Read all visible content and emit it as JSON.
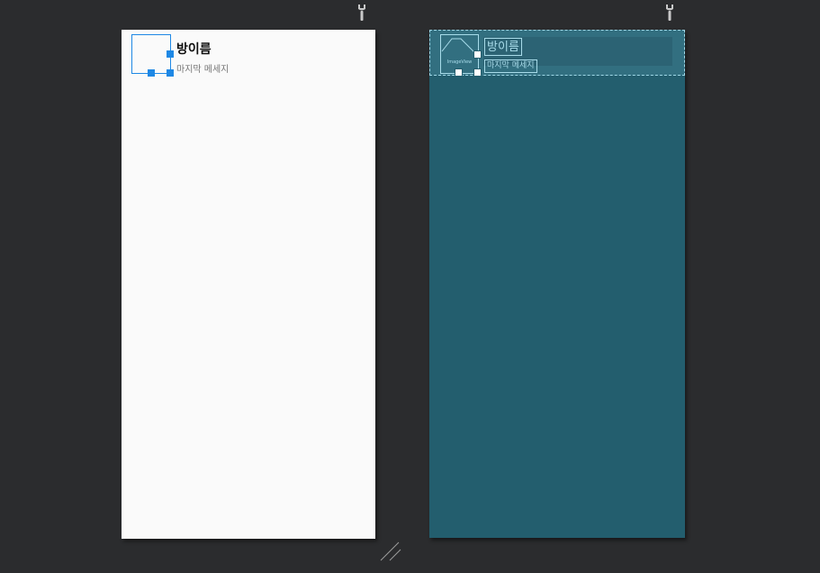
{
  "design": {
    "room_name": "방이름",
    "last_message": "마지막 메세지"
  },
  "blueprint": {
    "image_label": "ImageView",
    "room_name": "방이름",
    "last_message": "마지막 메세지"
  },
  "icons": {
    "design_attributes": "wrench-icon",
    "blueprint_attributes": "wrench-icon",
    "resize": "resize-handle-icon"
  },
  "colors": {
    "background": "#2b2c2e",
    "design_surface": "#fafafa",
    "blueprint_surface": "#235e6e",
    "selection": "#1e88e5",
    "blueprint_line": "#a8dcea"
  }
}
